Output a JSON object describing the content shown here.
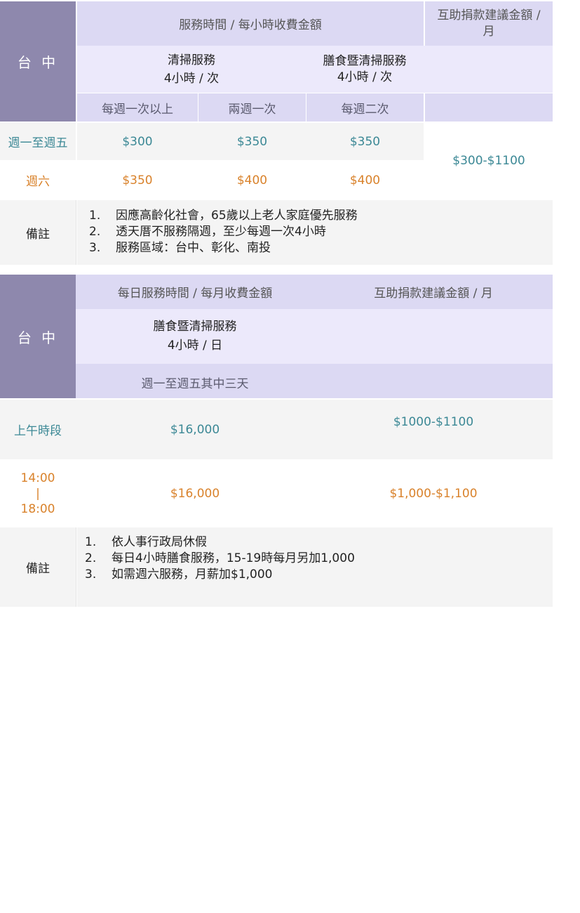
{
  "table1": {
    "city": "台 中",
    "header_service_time": "服務時間 / 每小時收費金額",
    "header_donation": "互助捐款建議金額 / 月",
    "service_cleaning_name": "清掃服務",
    "service_cleaning_duration": "4小時 / 次",
    "service_meal_name": "膳食暨清掃服務",
    "service_meal_duration": "4小時 / 次",
    "frequencies": [
      "每週一次以上",
      "兩週一次",
      "每週二次"
    ],
    "rows": [
      {
        "label": "週一至週五",
        "values": [
          "$300",
          "$350",
          "$350"
        ]
      },
      {
        "label": "週六",
        "values": [
          "$350",
          "$400",
          "$400"
        ]
      }
    ],
    "donation_value": "$300-$1100",
    "notes_label": "備註",
    "notes": [
      {
        "num": "1.",
        "text": "因應高齡化社會，65歲以上老人家庭優先服務"
      },
      {
        "num": "2.",
        "text": "透天厝不服務隔週，至少每週一次4小時"
      },
      {
        "num": "3.",
        "text": "服務區域：台中、彰化、南投"
      }
    ]
  },
  "table2": {
    "city": "台 中",
    "header_service_time": "每日服務時間 / 每月收費金額",
    "header_donation": "互助捐款建議金額 / 月",
    "service_meal_name": "膳食暨清掃服務",
    "service_meal_duration": "4小時 / 日",
    "frequency": "週一至週五其中三天",
    "rows": [
      {
        "label": "上午時段",
        "value": "$16,000",
        "donation": "$1000-$1100"
      },
      {
        "label_lines": [
          "14:00",
          "|",
          "18:00"
        ],
        "value": "$16,000",
        "donation": "$1,000-$1,100"
      }
    ],
    "notes_label": "備註",
    "notes": [
      {
        "num": "1.",
        "text": "依人事行政局休假"
      },
      {
        "num": "2.",
        "text": "每日4小時膳食服務，15-19時每月另加1,000"
      },
      {
        "num": "3.",
        "text": "如需週六服務，月薪加$1,000"
      }
    ]
  },
  "colors": {
    "city_bg": "#8e88ad",
    "header_bg": "#dcd9f3",
    "header_light_bg": "#ece9fb",
    "teal_text": "#3b8895",
    "orange_text": "#d9822b",
    "row_gray_bg": "#f4f4f4"
  }
}
